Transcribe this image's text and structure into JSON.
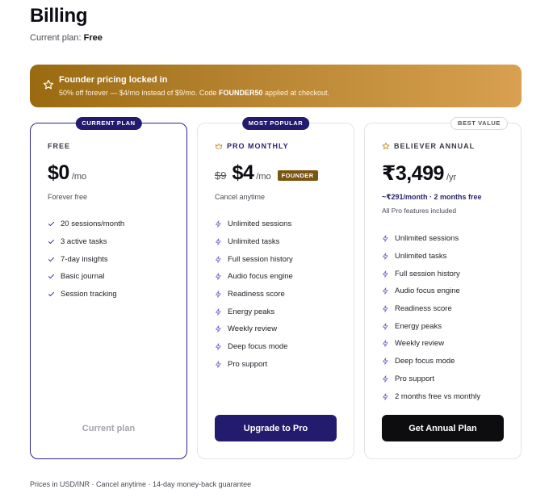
{
  "page": {
    "title": "Billing",
    "current_plan_label": "Current plan:",
    "current_plan_value": "Free"
  },
  "banner": {
    "title": "Founder pricing locked in",
    "subtitle_prefix": "50% off forever — $4/mo instead of $9/mo. Code ",
    "code": "FOUNDER50",
    "subtitle_suffix": " applied at checkout.",
    "icon": "star-icon"
  },
  "plans": {
    "free": {
      "badge": "CURRENT PLAN",
      "name": "FREE",
      "price": "$0",
      "period": "/mo",
      "note": "Forever free",
      "features": [
        "20 sessions/month",
        "3 active tasks",
        "7-day insights",
        "Basic journal",
        "Session tracking"
      ],
      "feature_icon": "check-icon",
      "cta": "Current plan"
    },
    "pro": {
      "badge": "MOST POPULAR",
      "name": "PRO MONTHLY",
      "name_icon": "crown-icon",
      "old_price": "$9",
      "price": "$4",
      "period": "/mo",
      "tag": "FOUNDER",
      "note": "Cancel anytime",
      "features": [
        "Unlimited sessions",
        "Unlimited tasks",
        "Full session history",
        "Audio focus engine",
        "Readiness score",
        "Energy peaks",
        "Weekly review",
        "Deep focus mode",
        "Pro support"
      ],
      "feature_icon": "bolt-icon",
      "cta": "Upgrade to Pro"
    },
    "annual": {
      "badge": "BEST VALUE",
      "name": "BELIEVER ANNUAL",
      "name_icon": "star-icon",
      "price": "₹3,499",
      "period": "/yr",
      "note": "~₹291/month · 2 months free",
      "note2": "All Pro features included",
      "features": [
        "Unlimited sessions",
        "Unlimited tasks",
        "Full session history",
        "Audio focus engine",
        "Readiness score",
        "Energy peaks",
        "Weekly review",
        "Deep focus mode",
        "Pro support",
        "2 months free vs monthly"
      ],
      "feature_icon": "bolt-icon",
      "cta": "Get Annual Plan"
    }
  },
  "footer": "Prices in USD/INR · Cancel anytime · 14-day money-back guarantee",
  "colors": {
    "brand_purple": "#231c6e",
    "founder_gold": "#b78532",
    "black": "#0d0d10"
  }
}
